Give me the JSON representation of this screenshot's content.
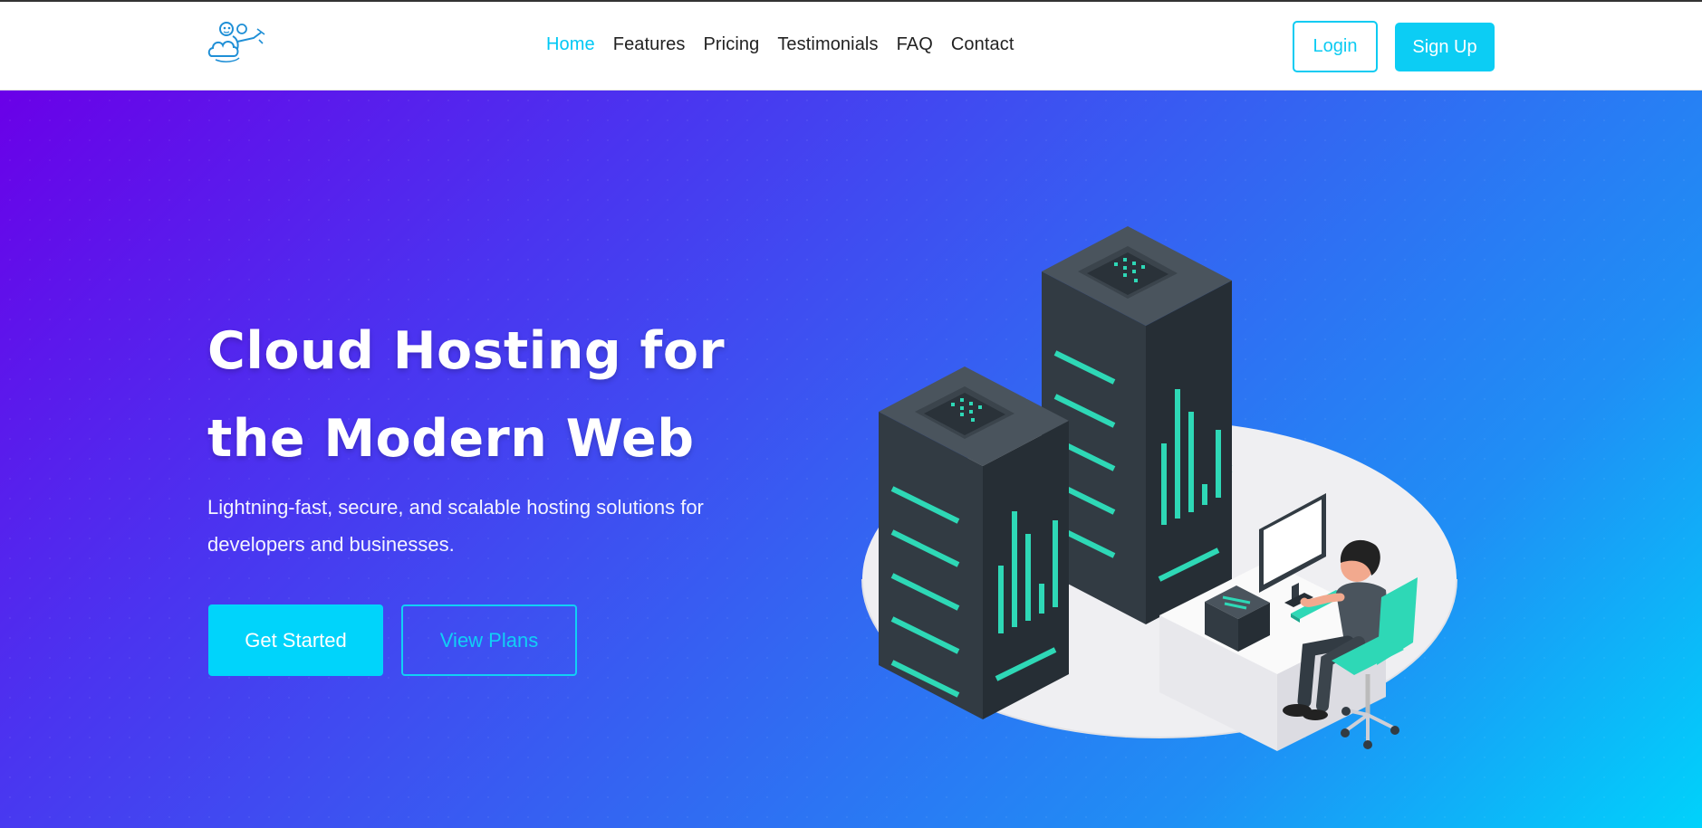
{
  "nav": {
    "links": [
      {
        "label": "Home",
        "active": true
      },
      {
        "label": "Features",
        "active": false
      },
      {
        "label": "Pricing",
        "active": false
      },
      {
        "label": "Testimonials",
        "active": false
      },
      {
        "label": "FAQ",
        "active": false
      },
      {
        "label": "Contact",
        "active": false
      }
    ],
    "login_label": "Login",
    "signup_label": "Sign Up"
  },
  "hero": {
    "title_line1": "Cloud Hosting for",
    "title_line2": "the Modern Web",
    "subtitle": "Lightning-fast, secure, and scalable hosting solutions for developers and businesses.",
    "primary_cta": "Get Started",
    "secondary_cta": "View Plans"
  },
  "colors": {
    "accent": "#0ccdf4",
    "gradient_start": "#6a00e8",
    "gradient_end": "#00d2fb",
    "server_body": "#37414a",
    "server_light": "#2ed8b6"
  },
  "icons": {
    "logo": "monkey-on-cloud-logo",
    "illustration": "server-racks-with-developer-illustration"
  }
}
